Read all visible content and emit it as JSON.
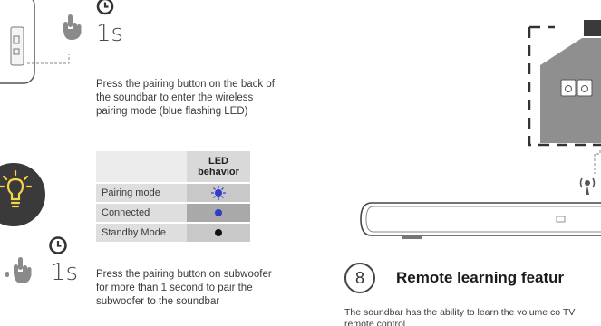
{
  "step_pairing": {
    "timer": "1s",
    "instruction": "Press the pairing button on the back of the soundbar to enter the wireless pairing mode (blue flashing LED)"
  },
  "led_table": {
    "header": "LED behavior",
    "rows": [
      {
        "mode": "Pairing mode",
        "indicator": "blue-flashing",
        "color": "#2f3cc8"
      },
      {
        "mode": "Connected",
        "indicator": "blue-solid",
        "color": "#2f3cc8"
      },
      {
        "mode": "Standby Mode",
        "indicator": "black-solid",
        "color": "#111111"
      }
    ]
  },
  "step_subwoofer": {
    "timer": "1s",
    "instruction": "Press the pairing button on subwoofer for more than 1 second to pair the subwoofer to the soundbar"
  },
  "section": {
    "number": "8",
    "title": "Remote learning featur",
    "body": "The soundbar has the ability to learn the volume co TV remote control"
  },
  "icons": [
    "clock-icon",
    "hand-press-icon",
    "lightbulb-icon",
    "wireless-signal-icon",
    "soundbar-illustration",
    "subwoofer-illustration",
    "wall-socket-illustration"
  ]
}
